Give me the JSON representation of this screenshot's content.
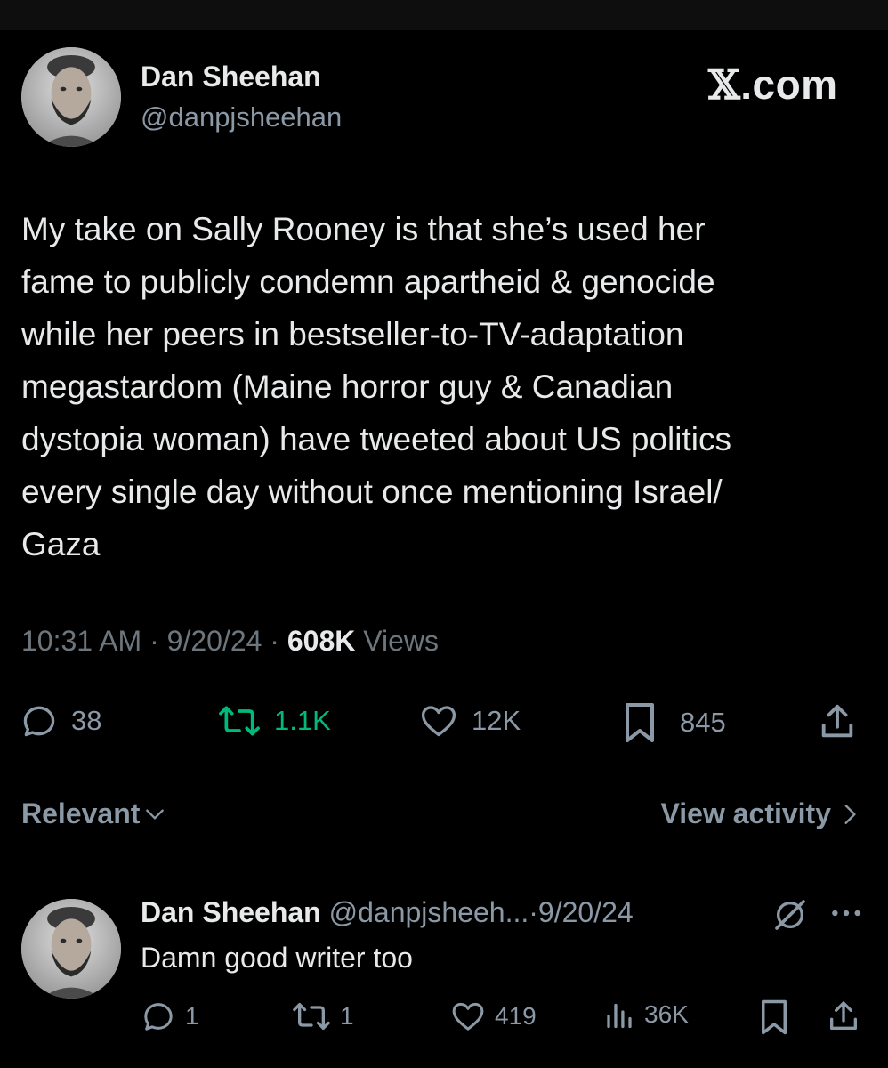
{
  "brand": {
    "label": "X.com"
  },
  "tweet": {
    "author_name": "Dan Sheehan",
    "author_handle": "@danpjsheehan",
    "text_lines": [
      "My take on Sally Rooney is that she’s used her",
      "fame to publicly condemn apartheid & genocide",
      "while her peers in bestseller-to-TV-adaptation",
      "megastardom (Maine horror guy & Canadian",
      "dystopia woman) have tweeted about US politics",
      "every single day without once mentioning Israel/",
      "Gaza"
    ],
    "time": "10:31 AM",
    "date": "9/20/24",
    "sep": "·",
    "views_count": "608K",
    "views_label": "Views",
    "stats": {
      "replies": "38",
      "reposts": "1.1K",
      "likes": "12K",
      "bookmarks": "845"
    }
  },
  "sort": {
    "label": "Relevant",
    "activity": "View activity"
  },
  "reply": {
    "author_name": "Dan Sheehan",
    "author_handle": "@danpjsheeh...",
    "sep": "·",
    "date": "9/20/24",
    "text": "Damn good writer too",
    "stats": {
      "replies": "1",
      "reposts": "1",
      "likes": "419",
      "views": "36K"
    }
  },
  "colors": {
    "background": "#000000",
    "text": "#e7e9ea",
    "muted": "#8b98a5",
    "repost_active": "#00ba7c",
    "divider": "#2f3336"
  }
}
